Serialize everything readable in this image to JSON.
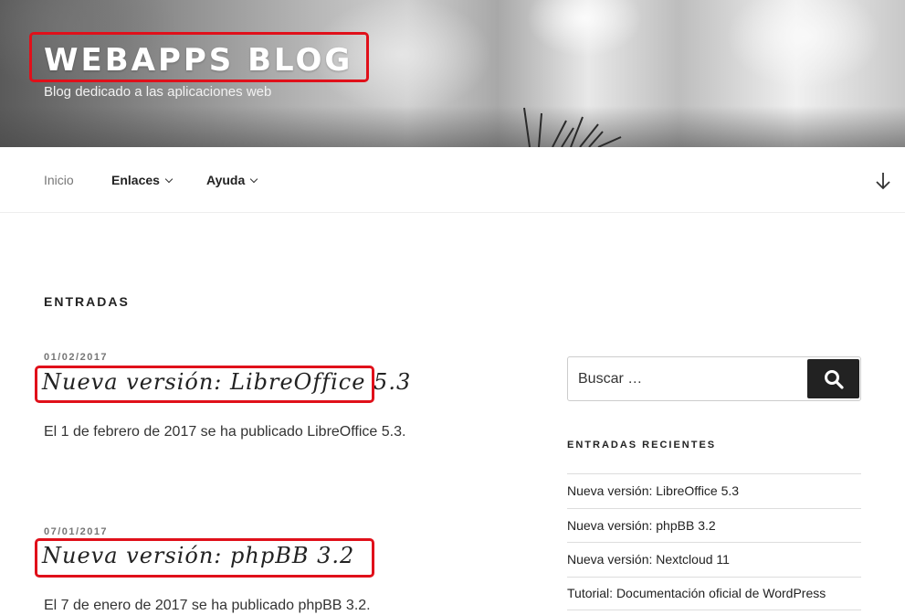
{
  "header": {
    "title": "WebApps Blog",
    "description": "Blog dedicado a las aplicaciones web"
  },
  "nav": {
    "items": [
      {
        "label": "Inicio",
        "current": true
      },
      {
        "label": "Enlaces",
        "has_submenu": true
      },
      {
        "label": "Ayuda",
        "has_submenu": true
      }
    ],
    "scroll_icon": "arrow-down-icon"
  },
  "main": {
    "heading": "ENTRADAS",
    "posts": [
      {
        "date": "01/02/2017",
        "title": "Nueva versión: LibreOffice 5.3",
        "excerpt": "El 1 de febrero de 2017 se ha publicado LibreOffice 5.3."
      },
      {
        "date": "07/01/2017",
        "title": "Nueva versión: phpBB 3.2",
        "excerpt": "El 7 de enero de 2017 se ha publicado phpBB 3.2."
      }
    ]
  },
  "sidebar": {
    "search": {
      "placeholder": "Buscar …",
      "icon": "search-icon"
    },
    "recent": {
      "title": "ENTRADAS RECIENTES",
      "items": [
        "Nueva versión: LibreOffice 5.3",
        "Nueva versión: phpBB 3.2",
        "Nueva versión: Nextcloud 11",
        "Tutorial: Documentación oficial de WordPress"
      ]
    }
  },
  "colors": {
    "highlight_border": "#e0101a",
    "search_button": "#222222"
  }
}
